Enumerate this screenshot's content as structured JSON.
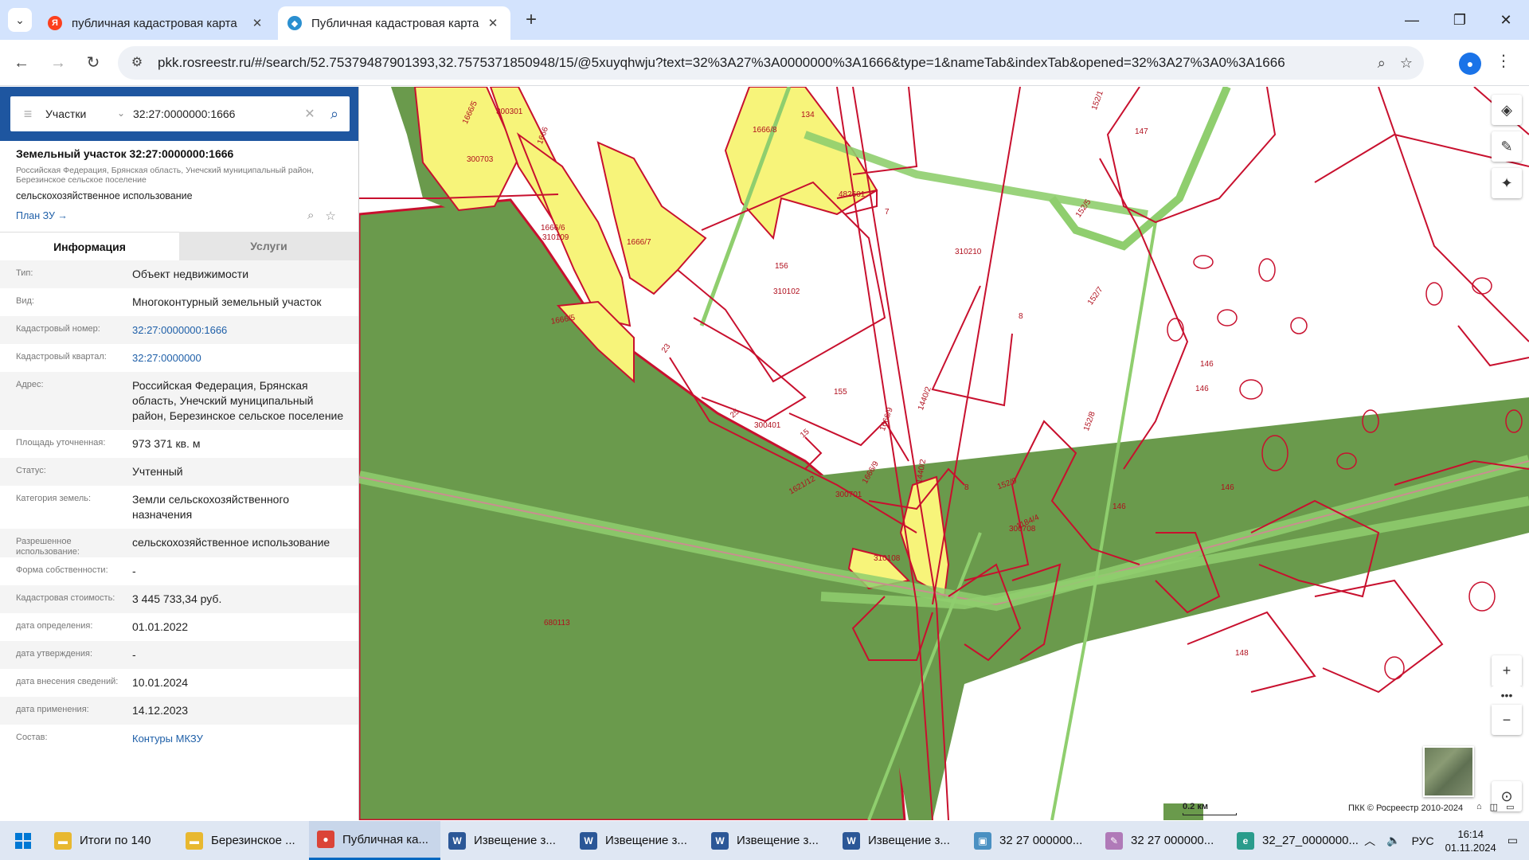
{
  "browser": {
    "tabs": [
      {
        "title": "публичная кадастровая карта",
        "favicon": "yandex-icon"
      },
      {
        "title": "Публичная кадастровая карта",
        "favicon": "rosreestr-icon"
      }
    ],
    "url": "pkk.rosreestr.ru/#/search/52.75379487901393,32.7575371850948/15/@5xuyqhwju?text=32%3A27%3A0000000%3A1666&type=1&nameTab&indexTab&opened=32%3A27%3A0%3A1666"
  },
  "search": {
    "category": "Участки",
    "value": "32:27:0000000:1666"
  },
  "object": {
    "title": "Земельный участок 32:27:0000000:1666",
    "address_line1": "Российская Федерация, Брянская область, Унечский муниципальный район,",
    "address_line2": "Березинское сельское поселение",
    "use": "сельскохозяйственное использование",
    "plan_link": "План ЗУ →"
  },
  "panel_tabs": {
    "info": "Информация",
    "services": "Услуги"
  },
  "details": [
    {
      "label": "Тип:",
      "value": "Объект недвижимости"
    },
    {
      "label": "Вид:",
      "value": "Многоконтурный земельный участок"
    },
    {
      "label": "Кадастровый номер:",
      "value": "32:27:0000000:1666",
      "link": true
    },
    {
      "label": "Кадастровый квартал:",
      "value": "32:27:0000000",
      "link": true
    },
    {
      "label": "Адрес:",
      "value": "Российская Федерация, Брянская область, Унечский муниципальный район, Березинское сельское поселение"
    },
    {
      "label": "Площадь уточненная:",
      "value": "973 371 кв. м"
    },
    {
      "label": "Статус:",
      "value": "Учтенный"
    },
    {
      "label": "Категория земель:",
      "value": "Земли сельскохозяйственного назначения"
    },
    {
      "label": "Разрешенное использование:",
      "value": "сельскохозяйственное использование"
    },
    {
      "label": "Форма собственности:",
      "value": "-"
    },
    {
      "label": "Кадастровая стоимость:",
      "value": "3 445 733,34 руб."
    },
    {
      "label": "дата определения:",
      "value": "01.01.2022"
    },
    {
      "label": "дата утверждения:",
      "value": "-"
    },
    {
      "label": "дата внесения сведений:",
      "value": "10.01.2024"
    },
    {
      "label": "дата применения:",
      "value": "14.12.2023"
    },
    {
      "label": "Состав:",
      "value": "Контуры МКЗУ",
      "link": true
    }
  ],
  "map": {
    "labels": [
      "300301",
      "1666/5",
      "300703",
      "1666",
      "1666/6",
      "310109",
      "1666/7",
      "1666/5",
      "1666/8",
      "134",
      "482601",
      "7",
      "156",
      "310102",
      "310210",
      "147",
      "152/1",
      "152/5",
      "152/7",
      "8",
      "146",
      "146",
      "23",
      "155",
      "25",
      "300401",
      "15",
      "1666/9",
      "1440/2",
      "1666/9",
      "1621/12",
      "300701",
      "1440/2",
      "8",
      "152/9",
      "152/8",
      "1184/4",
      "300708",
      "146",
      "146",
      "310108",
      "680113",
      "148"
    ],
    "scale_label": "0.2 км",
    "copyright": "ПКК © Росреестр 2010-2024"
  },
  "taskbar": {
    "items": [
      {
        "label": "Итоги по 140",
        "icon": "folder-icon"
      },
      {
        "label": "Березинское ...",
        "icon": "folder-icon"
      },
      {
        "label": "Публичная ка...",
        "icon": "chrome-icon"
      },
      {
        "label": "Извещение з...",
        "icon": "word-icon"
      },
      {
        "label": "Извещение з...",
        "icon": "word-icon"
      },
      {
        "label": "Извещение з...",
        "icon": "word-icon"
      },
      {
        "label": "Извещение з...",
        "icon": "word-icon"
      },
      {
        "label": "32  27  000000...",
        "icon": "image-viewer-icon"
      },
      {
        "label": "32  27  000000...",
        "icon": "paint-icon"
      },
      {
        "label": "32_27_0000000...",
        "icon": "edge-icon"
      }
    ],
    "language": "РУС",
    "time": "16:14",
    "date": "01.11.2024"
  },
  "colors": {
    "accent": "#1e56a0",
    "parcel_red": "#c8102e",
    "selected_yellow": "#f7f47a",
    "forest_green": "#6a9a4c",
    "road_green": "#8fce6e"
  }
}
